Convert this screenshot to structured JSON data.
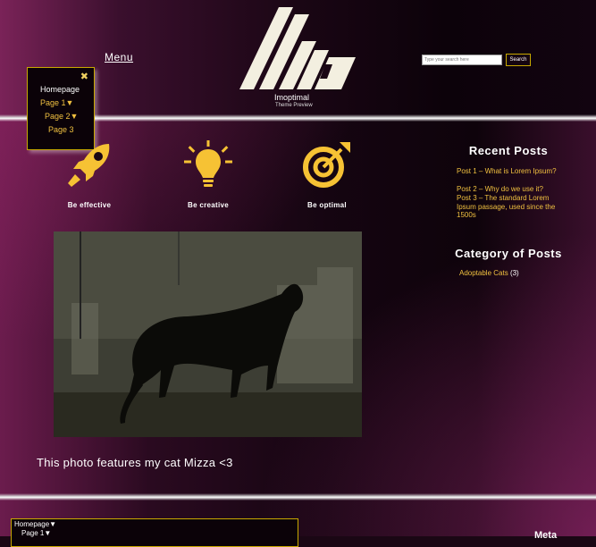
{
  "header": {
    "menu_label": "Menu",
    "logo_title": "Imoptimal",
    "logo_subtitle": "Theme Preview",
    "search": {
      "placeholder": "Type your search here",
      "button_label": "Search"
    }
  },
  "dropdown_menu": {
    "close_icon": "close-icon",
    "items": [
      {
        "label": "Homepage"
      },
      {
        "label": "Page 1▼"
      },
      {
        "label": "Page 2▼"
      },
      {
        "label": "Page 3"
      }
    ]
  },
  "features": [
    {
      "icon": "rocket-icon",
      "label": "Be effective"
    },
    {
      "icon": "lightbulb-icon",
      "label": "Be creative"
    },
    {
      "icon": "target-icon",
      "label": "Be optimal"
    }
  ],
  "main": {
    "caption": "This photo features my cat Mizza <3"
  },
  "sidebar": {
    "recent_posts_title": "Recent Posts",
    "recent_posts": [
      "Post 1 – What is Lorem Ipsum?",
      "Post 2 – Why do we use it?",
      "Post 3 – The standard Lorem Ipsum passage, used since the 1500s"
    ],
    "category_title": "Category of Posts",
    "categories": [
      {
        "label": "Adoptable Cats",
        "count": "(3)"
      }
    ]
  },
  "footer": {
    "menu_items": [
      {
        "label": "Homepage▼"
      },
      {
        "label": "Page 1▼"
      }
    ],
    "meta_title": "Meta"
  },
  "colors": {
    "accent": "#f0c040",
    "border": "#c8a800",
    "background": "#1a0714",
    "brand_magenta": "#7a2358"
  }
}
